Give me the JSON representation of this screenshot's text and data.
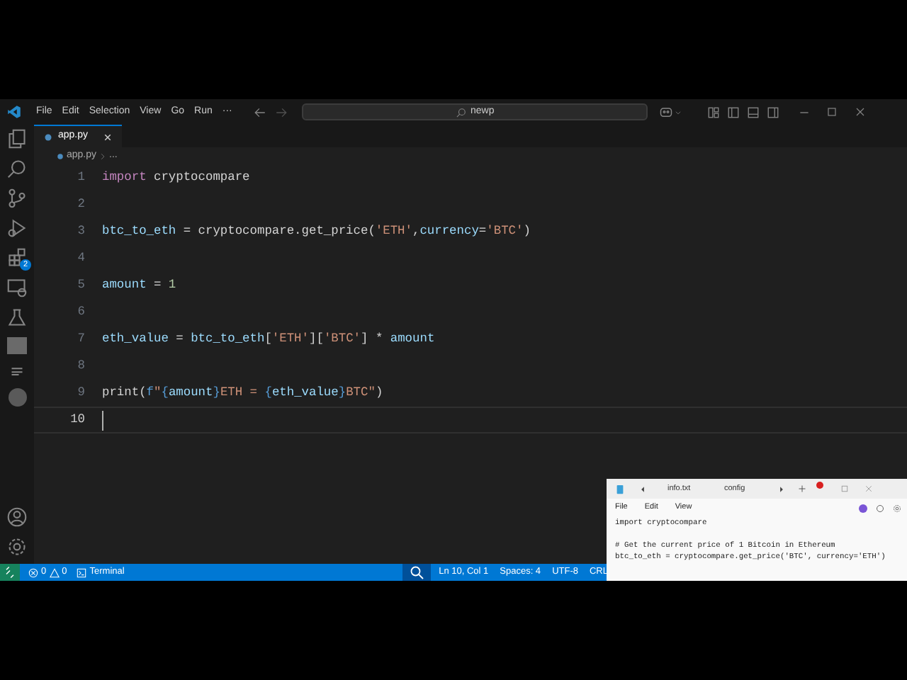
{
  "title_bar": {
    "menu": [
      "File",
      "Edit",
      "Selection",
      "View",
      "Go",
      "Run",
      "···"
    ],
    "command_center": "newp"
  },
  "tabs": [
    {
      "label": "app.py",
      "selected": true
    }
  ],
  "breadcrumb": {
    "file": "app.py",
    "symbol": "..."
  },
  "activity_bar": {
    "extensions_badge": "2"
  },
  "editor": {
    "lines": [
      {
        "number": "1",
        "current": false,
        "tokens": [
          {
            "kind": "keyword",
            "text": "import"
          },
          {
            "kind": "plain",
            "text": " cryptocompare"
          }
        ]
      },
      {
        "number": "2",
        "current": false
      },
      {
        "number": "3",
        "current": false,
        "tokens": [
          {
            "kind": "variable",
            "text": "btc_to_eth"
          },
          {
            "kind": "plain",
            "text": " = cryptocompare.get_price("
          },
          {
            "kind": "string",
            "text": "'ETH'"
          },
          {
            "kind": "plain",
            "text": ","
          },
          {
            "kind": "variable",
            "text": "currency"
          },
          {
            "kind": "plain",
            "text": "="
          },
          {
            "kind": "string",
            "text": "'BTC'"
          },
          {
            "kind": "plain",
            "text": ")"
          }
        ]
      },
      {
        "number": "4",
        "current": false
      },
      {
        "number": "5",
        "current": false,
        "tokens": [
          {
            "kind": "variable",
            "text": "amount"
          },
          {
            "kind": "plain",
            "text": " = "
          },
          {
            "kind": "number",
            "text": "1"
          }
        ]
      },
      {
        "number": "6",
        "current": false
      },
      {
        "number": "7",
        "current": false,
        "tokens": [
          {
            "kind": "variable",
            "text": "eth_value"
          },
          {
            "kind": "plain",
            "text": " = "
          },
          {
            "kind": "variable",
            "text": "btc_to_eth"
          },
          {
            "kind": "plain",
            "text": "["
          },
          {
            "kind": "string",
            "text": "'ETH'"
          },
          {
            "kind": "plain",
            "text": "]["
          },
          {
            "kind": "string",
            "text": "'BTC'"
          },
          {
            "kind": "plain",
            "text": "] * "
          },
          {
            "kind": "variable",
            "text": "amount"
          }
        ]
      },
      {
        "number": "8",
        "current": false
      },
      {
        "number": "9",
        "current": false,
        "tokens": [
          {
            "kind": "plain",
            "text": "print("
          },
          {
            "kind": "fprefix",
            "text": "f"
          },
          {
            "kind": "string",
            "text": "\""
          },
          {
            "kind": "brace",
            "text": "{"
          },
          {
            "kind": "variable",
            "text": "amount"
          },
          {
            "kind": "brace",
            "text": "}"
          },
          {
            "kind": "string",
            "text": "ETH = "
          },
          {
            "kind": "brace",
            "text": "{"
          },
          {
            "kind": "variable",
            "text": "eth_value"
          },
          {
            "kind": "brace",
            "text": "}"
          },
          {
            "kind": "string",
            "text": "BTC\""
          },
          {
            "kind": "plain",
            "text": ")"
          }
        ]
      },
      {
        "number": "10",
        "current": true
      }
    ]
  },
  "status_bar": {
    "errors": "0",
    "warnings": "0",
    "terminal": "Terminal",
    "position": "Ln 10, Col 1",
    "indent": "Spaces: 4",
    "encoding": "UTF-8",
    "eol": "CRL"
  },
  "notepad": {
    "tabs": [
      "info.txt",
      "config"
    ],
    "menu": [
      "File",
      "Edit",
      "View"
    ],
    "paragraphs": [
      [
        "import cryptocompare"
      ],
      [
        "# Get the current price of 1 Bitcoin in Ethereum",
        "btc_to_eth = cryptocompare.get_price('BTC', currency='ETH')"
      ]
    ]
  }
}
